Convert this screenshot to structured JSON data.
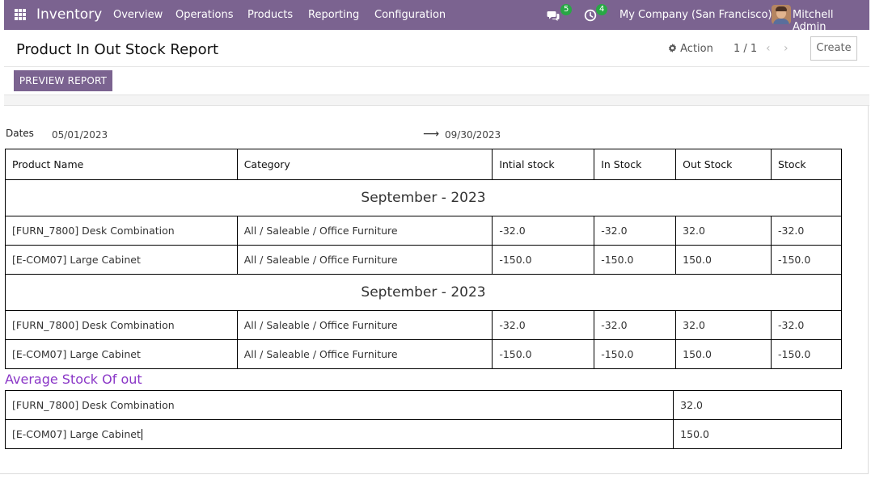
{
  "navbar": {
    "brand": "Inventory",
    "menu": [
      "Overview",
      "Operations",
      "Products",
      "Reporting",
      "Configuration"
    ],
    "messages_count": "5",
    "activities_count": "4",
    "company": "My Company (San Francisco)",
    "user": "Mitchell Admin",
    "accent_color": "#7b6390"
  },
  "control_panel": {
    "title": "Product In Out Stock Report",
    "action_label": "Action",
    "pager": "1 / 1",
    "create_label": "Create",
    "preview_label": "PREVIEW REPORT"
  },
  "report": {
    "dates_label": "Dates",
    "date_from": "05/01/2023",
    "date_to": "09/30/2023",
    "headers": [
      "Product Name",
      "Category",
      "Intial stock",
      "In Stock",
      "Out Stock",
      "Stock"
    ],
    "groups": [
      {
        "month": "September - 2023",
        "rows": [
          [
            "[FURN_7800] Desk Combination",
            "All / Saleable / Office Furniture",
            "-32.0",
            "-32.0",
            "32.0",
            "-32.0"
          ],
          [
            "[E-COM07] Large Cabinet",
            "All / Saleable / Office Furniture",
            "-150.0",
            "-150.0",
            "150.0",
            "-150.0"
          ]
        ]
      },
      {
        "month": "September - 2023",
        "rows": [
          [
            "[FURN_7800] Desk Combination",
            "All / Saleable / Office Furniture",
            "-32.0",
            "-32.0",
            "32.0",
            "-32.0"
          ],
          [
            "[E-COM07] Large Cabinet",
            "All / Saleable / Office Furniture",
            "-150.0",
            "-150.0",
            "150.0",
            "-150.0"
          ]
        ]
      }
    ],
    "average_title": "Average Stock Of out",
    "average_rows": [
      [
        "[FURN_7800] Desk Combination",
        "32.0"
      ],
      [
        "[E-COM07] Large Cabinet",
        "150.0"
      ]
    ],
    "average_title_color": "#8a36c7"
  }
}
